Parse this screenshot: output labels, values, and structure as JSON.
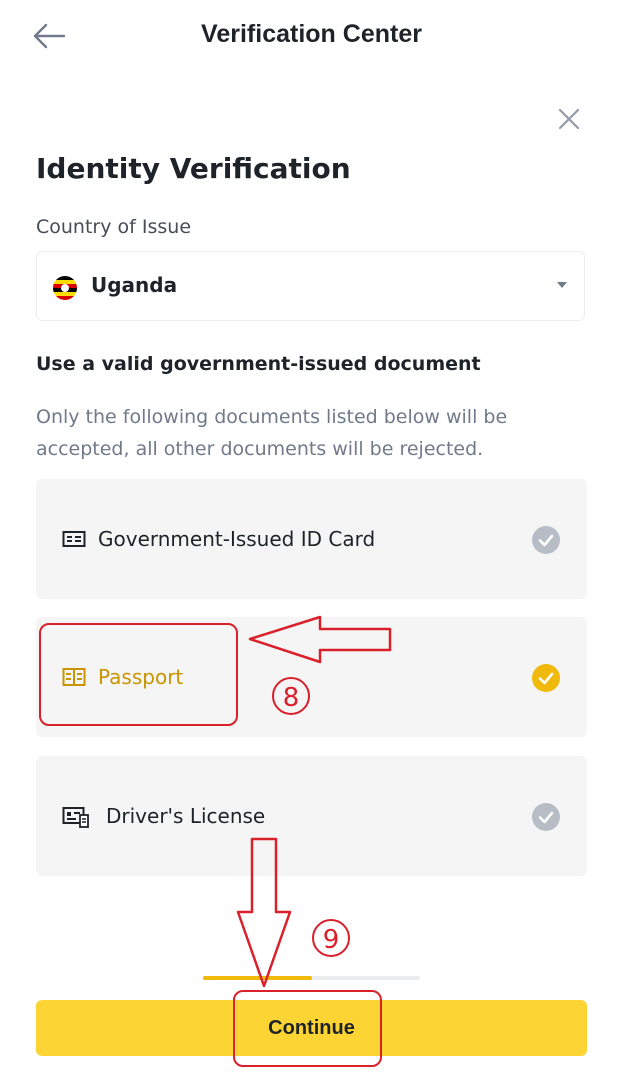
{
  "header": {
    "title": "Verification Center",
    "back_icon": "arrow-left-icon",
    "close_icon": "close-icon"
  },
  "form": {
    "title": "Identity Verification",
    "country_label": "Country of Issue",
    "country_value": "Uganda",
    "country_flag_icon": "uganda-flag-icon",
    "doc_heading": "Use a valid government-issued document",
    "doc_description": "Only the following documents listed below will be accepted, all other documents will be rejected.",
    "documents": [
      {
        "label": "Government-Issued ID Card",
        "icon": "id-card-icon",
        "selected": false
      },
      {
        "label": "Passport",
        "icon": "passport-icon",
        "selected": true
      },
      {
        "label": "Driver's License",
        "icon": "drivers-license-icon",
        "selected": false
      }
    ]
  },
  "progress": {
    "fraction": 0.5
  },
  "continue_label": "Continue",
  "annotations": {
    "step_a": "8",
    "step_b": "9"
  },
  "colors": {
    "accent": "#F0B90B",
    "button": "#FCD535",
    "selected_text": "#C99400",
    "check_inactive": "#B7BDC6",
    "card_bg": "#F5F5F5",
    "annotation": "#D9202B"
  }
}
